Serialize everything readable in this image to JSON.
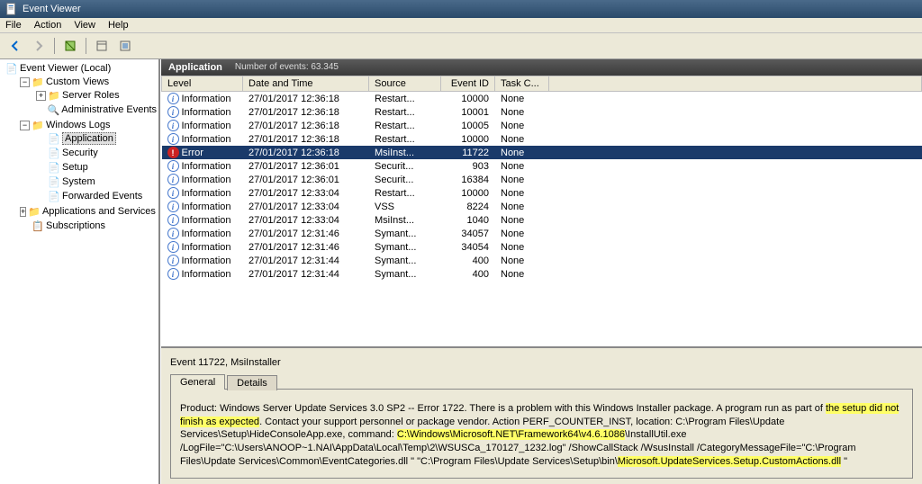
{
  "window": {
    "title": "Event Viewer"
  },
  "menu": [
    "File",
    "Action",
    "View",
    "Help"
  ],
  "tree": {
    "root": "Event Viewer (Local)",
    "custom_views": "Custom Views",
    "server_roles": "Server Roles",
    "admin_events": "Administrative Events",
    "win_logs": "Windows Logs",
    "application": "Application",
    "security": "Security",
    "setup": "Setup",
    "system": "System",
    "forwarded": "Forwarded Events",
    "apps_services": "Applications and Services Logs",
    "subscriptions": "Subscriptions"
  },
  "panel": {
    "title": "Application",
    "count": "Number of events: 63.345"
  },
  "columns": {
    "level": "Level",
    "date": "Date and Time",
    "source": "Source",
    "eid": "Event ID",
    "task": "Task C..."
  },
  "events": [
    {
      "level": "Information",
      "date": "27/01/2017 12:36:18",
      "source": "Restart...",
      "eid": "10000",
      "task": "None"
    },
    {
      "level": "Information",
      "date": "27/01/2017 12:36:18",
      "source": "Restart...",
      "eid": "10001",
      "task": "None"
    },
    {
      "level": "Information",
      "date": "27/01/2017 12:36:18",
      "source": "Restart...",
      "eid": "10005",
      "task": "None"
    },
    {
      "level": "Information",
      "date": "27/01/2017 12:36:18",
      "source": "Restart...",
      "eid": "10000",
      "task": "None"
    },
    {
      "level": "Error",
      "date": "27/01/2017 12:36:18",
      "source": "MsiInst...",
      "eid": "11722",
      "task": "None",
      "sel": true
    },
    {
      "level": "Information",
      "date": "27/01/2017 12:36:01",
      "source": "Securit...",
      "eid": "903",
      "task": "None"
    },
    {
      "level": "Information",
      "date": "27/01/2017 12:36:01",
      "source": "Securit...",
      "eid": "16384",
      "task": "None"
    },
    {
      "level": "Information",
      "date": "27/01/2017 12:33:04",
      "source": "Restart...",
      "eid": "10000",
      "task": "None"
    },
    {
      "level": "Information",
      "date": "27/01/2017 12:33:04",
      "source": "VSS",
      "eid": "8224",
      "task": "None"
    },
    {
      "level": "Information",
      "date": "27/01/2017 12:33:04",
      "source": "MsiInst...",
      "eid": "1040",
      "task": "None"
    },
    {
      "level": "Information",
      "date": "27/01/2017 12:31:46",
      "source": "Symant...",
      "eid": "34057",
      "task": "None"
    },
    {
      "level": "Information",
      "date": "27/01/2017 12:31:46",
      "source": "Symant...",
      "eid": "34054",
      "task": "None"
    },
    {
      "level": "Information",
      "date": "27/01/2017 12:31:44",
      "source": "Symant...",
      "eid": "400",
      "task": "None"
    },
    {
      "level": "Information",
      "date": "27/01/2017 12:31:44",
      "source": "Symant...",
      "eid": "400",
      "task": "None"
    }
  ],
  "detail": {
    "header": "Event 11722, MsiInstaller",
    "tab_general": "General",
    "tab_details": "Details",
    "p1": "Product: Windows Server Update Services 3.0 SP2 -- Error 1722. There is a problem with this Windows Installer package. A program run as part of ",
    "hl1": "the setup did not finish as expected",
    "p2": ". Contact your support personnel or package vendor.  Action PERF_COUNTER_INST, location: C:\\Program Files\\Update Services\\Setup\\HideConsoleApp.exe, command: ",
    "hl2": "C:\\Windows\\Microsoft.NET\\Framework64\\v4.6.1086",
    "p3": "\\InstallUtil.exe /LogFile=\"C:\\Users\\ANOOP~1.NAI\\AppData\\Local\\Temp\\2\\WSUSCa_170127_1232.log\" /ShowCallStack /WsusInstall /CategoryMessageFile=\"C:\\Program Files\\Update Services\\Common\\EventCategories.dll \" \"C:\\Program Files\\Update Services\\Setup\\bin\\",
    "hl3": "Microsoft.UpdateServices.Setup.CustomActions.dll",
    "p4": " \""
  }
}
